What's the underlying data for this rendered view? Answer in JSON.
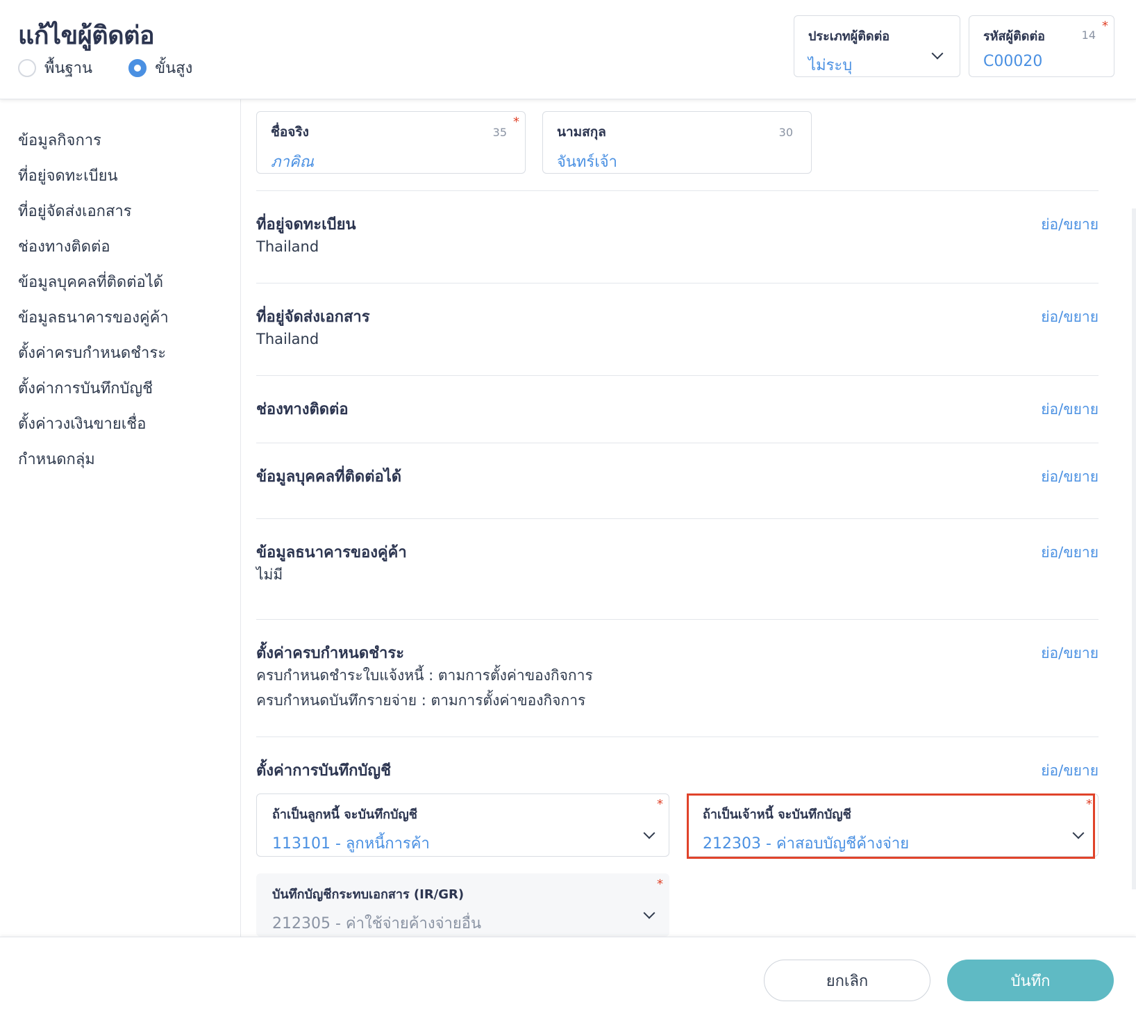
{
  "header": {
    "title": "แก้ไขผู้ติดต่อ",
    "mode_basic": "พื้นฐาน",
    "mode_advanced": "ขั้นสูง",
    "contact_type_label": "ประเภทผู้ติดต่อ",
    "contact_type_value": "ไม่ระบุ",
    "contact_code_label": "รหัสผู้ติดต่อ",
    "contact_code_value": "C00020",
    "contact_code_counter": "14"
  },
  "sidebar": {
    "items": [
      {
        "label": "ข้อมูลกิจการ"
      },
      {
        "label": "ที่อยู่จดทะเบียน"
      },
      {
        "label": "ที่อยู่จัดส่งเอกสาร"
      },
      {
        "label": "ช่องทางติดต่อ"
      },
      {
        "label": "ข้อมูลบุคคลที่ติดต่อได้"
      },
      {
        "label": "ข้อมูลธนาคารของคู่ค้า"
      },
      {
        "label": "ตั้งค่าครบกำหนดชำระ"
      },
      {
        "label": "ตั้งค่าการบันทึกบัญชี"
      },
      {
        "label": "ตั้งค่าวงเงินขายเชื่อ"
      },
      {
        "label": "กำหนดกลุ่ม"
      }
    ]
  },
  "name_fields": {
    "first_name_label": "ชื่อจริง",
    "first_name_value": "ภาคิณ",
    "first_name_counter": "35",
    "last_name_label": "นามสกุล",
    "last_name_value": "จันทร์เจ้า",
    "last_name_counter": "30"
  },
  "toggle_label": "ย่อ/ขยาย",
  "sections": {
    "registered_address": {
      "title": "ที่อยู่จดทะเบียน",
      "value": "Thailand"
    },
    "shipping_address": {
      "title": "ที่อยู่จัดส่งเอกสาร",
      "value": "Thailand"
    },
    "contact_channels": {
      "title": "ช่องทางติดต่อ"
    },
    "contact_persons": {
      "title": "ข้อมูลบุคคลที่ติดต่อได้"
    },
    "bank_info": {
      "title": "ข้อมูลธนาคารของคู่ค้า",
      "value": "ไม่มี"
    },
    "payment_terms": {
      "title": "ตั้งค่าครบกำหนดชำระ",
      "line1": "ครบกำหนดชำระใบแจ้งหนี้ : ตามการตั้งค่าของกิจการ",
      "line2": "ครบกำหนดบันทึกรายจ่าย : ตามการตั้งค่าของกิจการ"
    },
    "accounting": {
      "title": "ตั้งค่าการบันทึกบัญชี",
      "debtor_label": "ถ้าเป็นลูกหนี้ จะบันทึกบัญชี",
      "debtor_value": "113101 - ลูกหนี้การค้า",
      "creditor_label": "ถ้าเป็นเจ้าหนี้ จะบันทึกบัญชี",
      "creditor_value": "212303 - ค่าสอบบัญชีค้างจ่าย",
      "irgr_label": "บันทึกบัญชีกระทบเอกสาร (IR/GR)",
      "irgr_value": "212305 - ค่าใช้จ่ายค้างจ่ายอื่น"
    }
  },
  "footer": {
    "cancel_label": "ยกเลิก",
    "save_label": "บันทึก"
  },
  "colors": {
    "accent": "#4a90e2",
    "save_button": "#5fbac4",
    "required": "#e0432a",
    "highlight": "#e0432a"
  }
}
